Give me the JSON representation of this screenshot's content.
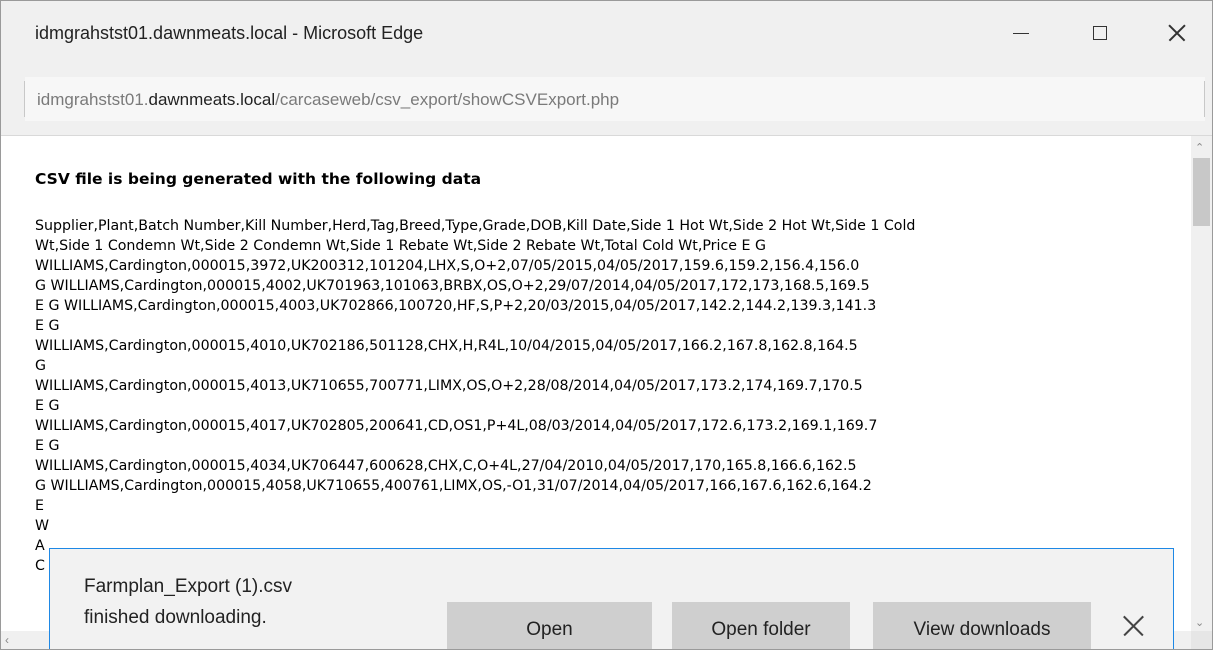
{
  "window": {
    "title": "idmgrahstst01.dawnmeats.local - Microsoft Edge"
  },
  "address": {
    "prefix": "idmgrahstst01.",
    "host": "dawnmeats.local",
    "path": "/carcaseweb/csv_export/showCSVExport.php"
  },
  "content": {
    "heading": "CSV file is being generated with the following data",
    "lines": [
      "Supplier,Plant,Batch Number,Kill Number,Herd,Tag,Breed,Type,Grade,DOB,Kill Date,Side 1 Hot Wt,Side 2 Hot Wt,Side 1 Cold",
      "Wt,Side 1 Condemn Wt,Side 2 Condemn Wt,Side 1 Rebate Wt,Side 2 Rebate Wt,Total Cold Wt,Price E G",
      "WILLIAMS,Cardington,000015,3972,UK200312,101204,LHX,S,O+2,07/05/2015,04/05/2017,159.6,159.2,156.4,156.0",
      "G WILLIAMS,Cardington,000015,4002,UK701963,101063,BRBX,OS,O+2,29/07/2014,04/05/2017,172,173,168.5,169.5",
      "E G WILLIAMS,Cardington,000015,4003,UK702866,100720,HF,S,P+2,20/03/2015,04/05/2017,142.2,144.2,139.3,141.3",
      "E G",
      "WILLIAMS,Cardington,000015,4010,UK702186,501128,CHX,H,R4L,10/04/2015,04/05/2017,166.2,167.8,162.8,164.5",
      "G",
      "WILLIAMS,Cardington,000015,4013,UK710655,700771,LIMX,OS,O+2,28/08/2014,04/05/2017,173.2,174,169.7,170.5",
      "E G",
      "WILLIAMS,Cardington,000015,4017,UK702805,200641,CD,OS1,P+4L,08/03/2014,04/05/2017,172.6,173.2,169.1,169.7",
      "E G",
      "WILLIAMS,Cardington,000015,4034,UK706447,600628,CHX,C,O+4L,27/04/2010,04/05/2017,170,165.8,166.6,162.5",
      "G WILLIAMS,Cardington,000015,4058,UK710655,400761,LIMX,OS,-O1,31/07/2014,04/05/2017,166,167.6,162.6,164.2",
      "E",
      "W",
      "A",
      "C"
    ]
  },
  "download": {
    "filename": "Farmplan_Export (1).csv",
    "status": "finished downloading.",
    "open_label": "Open",
    "open_folder_label": "Open folder",
    "view_downloads_label": "View downloads"
  }
}
